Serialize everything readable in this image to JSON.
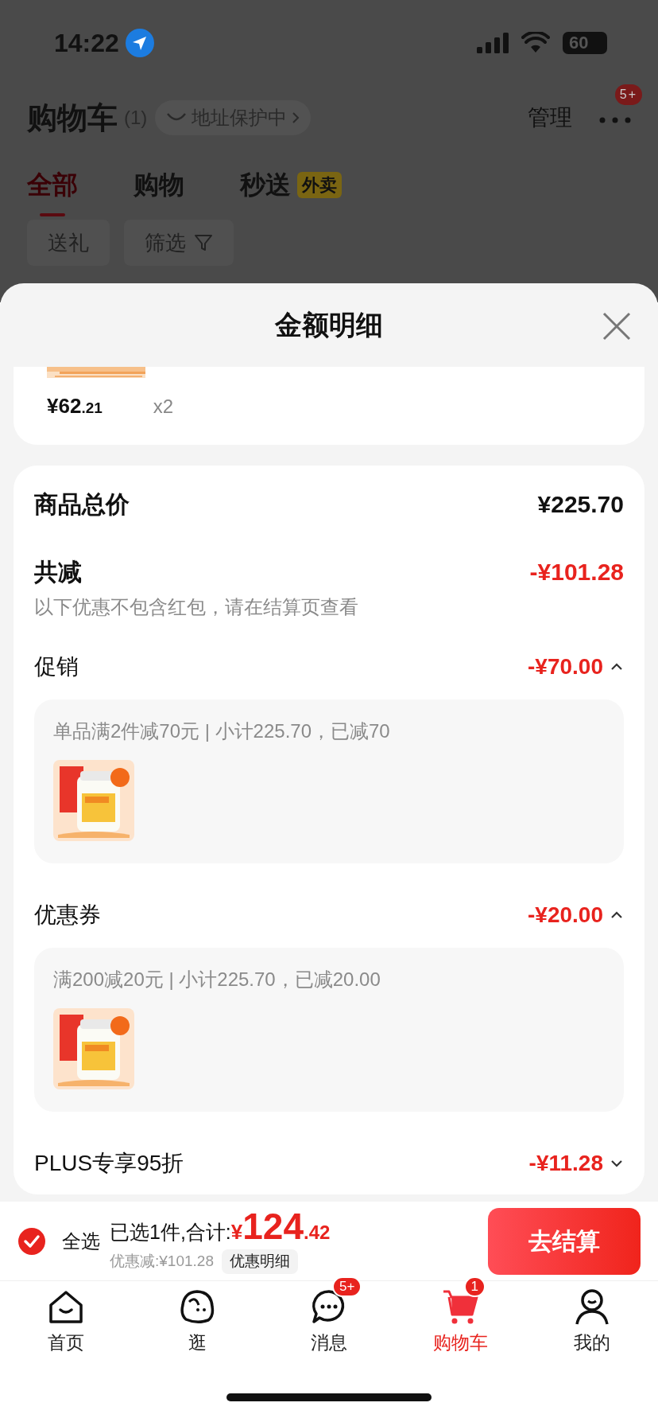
{
  "status_bar": {
    "time": "14:22",
    "battery": "60"
  },
  "header": {
    "title": "购物车",
    "count": "(1)",
    "address_chip": "地址保护中",
    "manage": "管理",
    "more_badge": "5+"
  },
  "tabs": [
    {
      "label": "全部",
      "selected": true
    },
    {
      "label": "购物",
      "selected": false
    },
    {
      "label": "秒送",
      "tag": "外卖",
      "selected": false
    }
  ],
  "filters": [
    {
      "label": "送礼",
      "kind": "plain"
    },
    {
      "label": "筛选",
      "kind": "filter"
    }
  ],
  "sheet": {
    "title": "金额明细"
  },
  "item": {
    "price_main": "¥62",
    "price_cents": ".21",
    "qty": "x2"
  },
  "summary": {
    "total_label": "商品总价",
    "total": "¥225.70",
    "reduction_label": "共减",
    "reduction": "-¥101.28",
    "note": "以下优惠不包含红包，请在结算页查看"
  },
  "discounts": [
    {
      "label": "促销",
      "amount": "-¥70.00",
      "expanded": true,
      "detail": "单品满2件减70元 | 小计225.70，已减70"
    },
    {
      "label": "优惠券",
      "amount": "-¥20.00",
      "expanded": true,
      "detail": "满200减20元 | 小计225.70，已减20.00"
    },
    {
      "label": "PLUS专享95折",
      "amount": "-¥11.28",
      "expanded": false
    }
  ],
  "checkout": {
    "select_all": {
      "label": "全选",
      "checked": true
    },
    "selected_text": "已选1件,合计:",
    "currency": "¥",
    "total_int": "124",
    "total_dec": ".42",
    "discount_text": "优惠减:¥101.28",
    "detail_button": "优惠明细",
    "checkout_button": "去结算"
  },
  "tabbar": [
    {
      "label": "首页",
      "kind": "home",
      "selected": false
    },
    {
      "label": "逛",
      "kind": "stroll",
      "selected": false
    },
    {
      "label": "消息",
      "kind": "message",
      "badge": "5+",
      "selected": false
    },
    {
      "label": "购物车",
      "kind": "cart",
      "badge": "1",
      "selected": true
    },
    {
      "label": "我的",
      "kind": "profile",
      "selected": false
    }
  ]
}
